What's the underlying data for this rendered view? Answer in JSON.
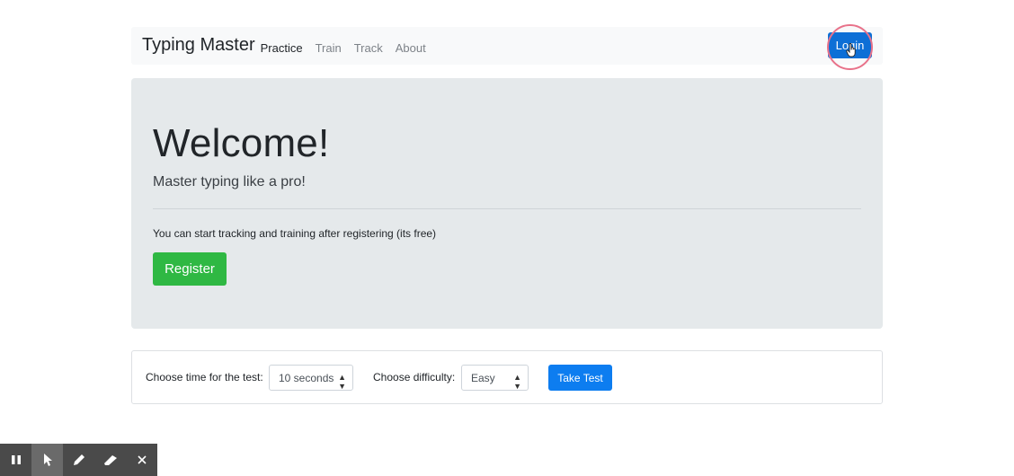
{
  "navbar": {
    "brand": "Typing Master",
    "links": [
      {
        "label": "Practice",
        "active": true
      },
      {
        "label": "Train",
        "active": false
      },
      {
        "label": "Track",
        "active": false
      },
      {
        "label": "About",
        "active": false
      }
    ],
    "login_label": "Login"
  },
  "jumbotron": {
    "title": "Welcome!",
    "lead": "Master typing like a pro!",
    "text": "You can start tracking and training after registering (its free)",
    "register_label": "Register"
  },
  "test_panel": {
    "time_label": "Choose time for the test:",
    "time_value": "10 seconds",
    "difficulty_label": "Choose difficulty:",
    "difficulty_value": "Easy",
    "take_test_label": "Take Test"
  },
  "recorder_toolbar": {
    "tools": [
      "pause-icon",
      "pointer-icon",
      "pen-icon",
      "eraser-icon",
      "close-icon"
    ],
    "selected": "pointer-icon"
  },
  "colors": {
    "primary": "#0d6fd6",
    "success": "#2fb843",
    "jumbotron_bg": "#e5e9eb",
    "click_ring": "#e8728a"
  }
}
